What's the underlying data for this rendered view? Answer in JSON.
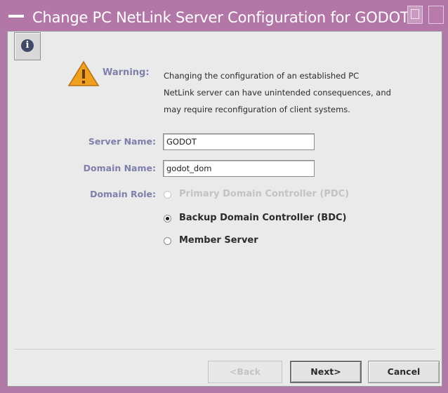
{
  "window": {
    "title": "Change PC NetLink Server Configuration for GODOT"
  },
  "colors": {
    "title_bar": "#b377a7",
    "label_color": "#7e7fab",
    "warning_triangle": "#f0a020"
  },
  "icons": {
    "info": "info-icon",
    "warning": "warning-triangle-icon"
  },
  "warning": {
    "label": "Warning:",
    "lines": [
      "Changing the configuration of an established PC",
      "NetLink server can have unintended consequences, and",
      "may require reconfiguration of client systems."
    ]
  },
  "form": {
    "server_name": {
      "label": "Server Name:",
      "value": "GODOT"
    },
    "domain_name": {
      "label": "Domain Name:",
      "value": "godot_dom"
    },
    "domain_role": {
      "label": "Domain Role:",
      "options": [
        {
          "label": "Primary Domain Controller (PDC)",
          "selected": false,
          "disabled": true
        },
        {
          "label": "Backup Domain Controller (BDC)",
          "selected": true,
          "disabled": false
        },
        {
          "label": "Member Server",
          "selected": false,
          "disabled": false
        }
      ]
    }
  },
  "buttons": {
    "back": "<Back",
    "next": "Next>",
    "cancel": "Cancel"
  }
}
